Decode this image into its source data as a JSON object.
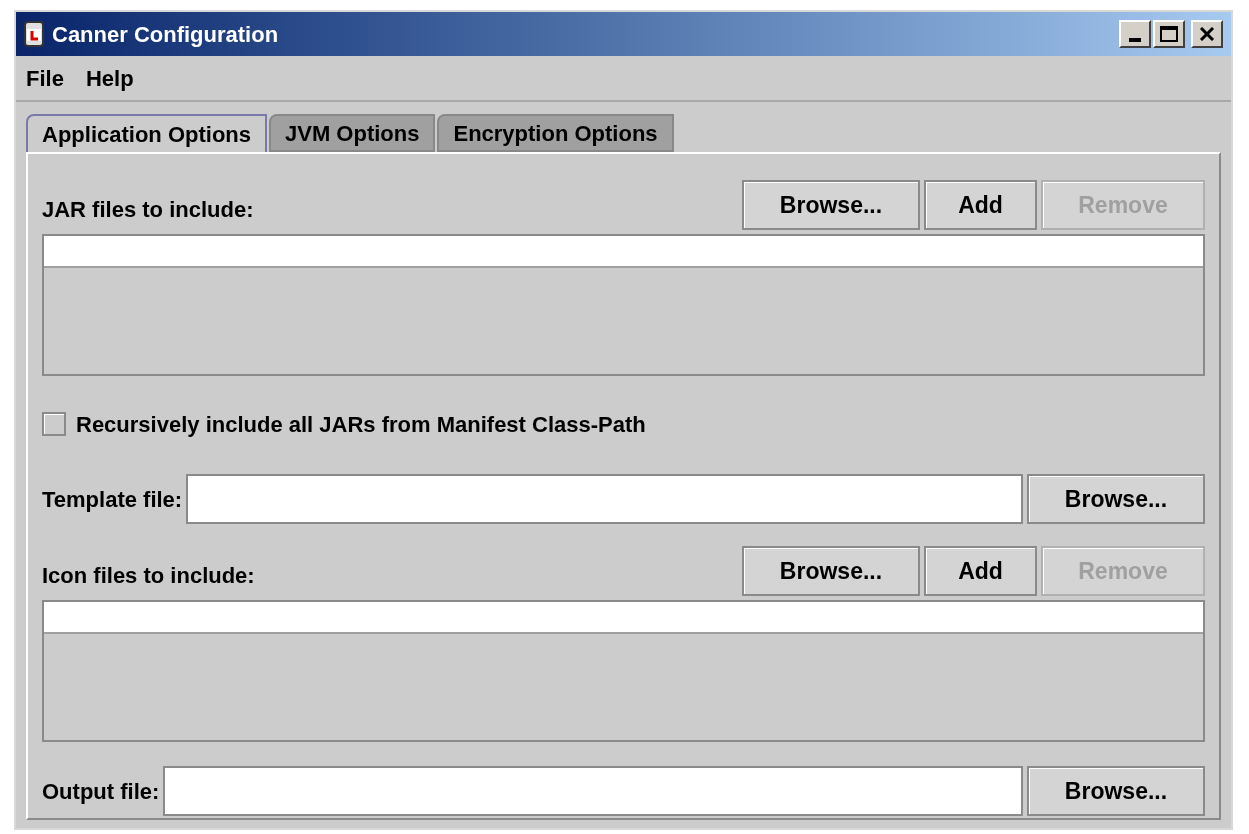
{
  "window": {
    "title": "Canner Configuration"
  },
  "menu": [
    "File",
    "Help"
  ],
  "tabs": [
    {
      "label": "Application Options",
      "selected": true
    },
    {
      "label": "JVM Options",
      "selected": false
    },
    {
      "label": "Encryption Options",
      "selected": false
    }
  ],
  "sections": [
    {
      "kind": "list",
      "label": "JAR files to include:",
      "buttons": [
        {
          "label": "Browse...",
          "disabled": false
        },
        {
          "label": "Add",
          "disabled": false
        },
        {
          "label": "Remove",
          "disabled": true
        }
      ]
    },
    {
      "kind": "checkbox",
      "label": "Recursively include all JARs from Manifest Class-Path",
      "checked": false
    },
    {
      "kind": "file",
      "label": "Template file:",
      "button": {
        "label": "Browse...",
        "disabled": false
      }
    },
    {
      "kind": "list",
      "label": "Icon files to include:",
      "buttons": [
        {
          "label": "Browse...",
          "disabled": false
        },
        {
          "label": "Add",
          "disabled": false
        },
        {
          "label": "Remove",
          "disabled": true
        }
      ]
    },
    {
      "kind": "file",
      "label": "Output file:",
      "button": {
        "label": "Browse...",
        "disabled": false
      }
    }
  ]
}
